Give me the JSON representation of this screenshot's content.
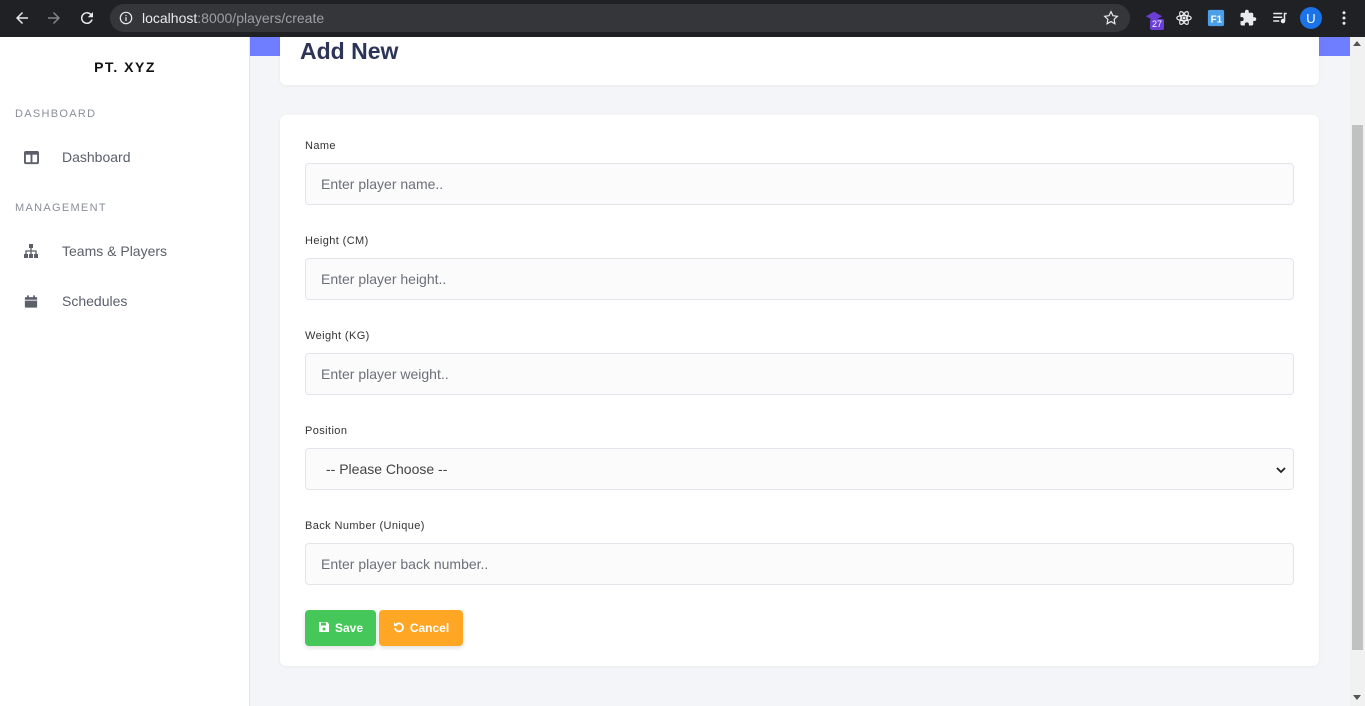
{
  "browser": {
    "url_host": "localhost",
    "url_rest": ":8000/players/create",
    "extension_badge": "27",
    "avatar_letter": "U",
    "ext_f_label": "F1"
  },
  "sidebar": {
    "brand": "PT. XYZ",
    "sections": [
      {
        "title": "DASHBOARD",
        "items": [
          {
            "label": "Dashboard",
            "icon": "columns-icon"
          }
        ]
      },
      {
        "title": "MANAGEMENT",
        "items": [
          {
            "label": "Teams & Players",
            "icon": "sitemap-icon"
          },
          {
            "label": "Schedules",
            "icon": "calendar-icon"
          }
        ]
      }
    ]
  },
  "header": {
    "title": "Add New"
  },
  "form": {
    "fields": [
      {
        "label": "Name",
        "placeholder": "Enter player name.."
      },
      {
        "label": "Height (CM)",
        "placeholder": "Enter player height.."
      },
      {
        "label": "Weight (KG)",
        "placeholder": "Enter player weight.."
      },
      {
        "label": "Position",
        "selected": "-- Please Choose --"
      },
      {
        "label": "Back Number (Unique)",
        "placeholder": "Enter player back number.."
      }
    ],
    "save_label": "Save",
    "cancel_label": "Cancel"
  },
  "colors": {
    "accent": "#6f7dff",
    "save": "#45c75a",
    "cancel": "#ffa724",
    "title": "#2c3458"
  }
}
